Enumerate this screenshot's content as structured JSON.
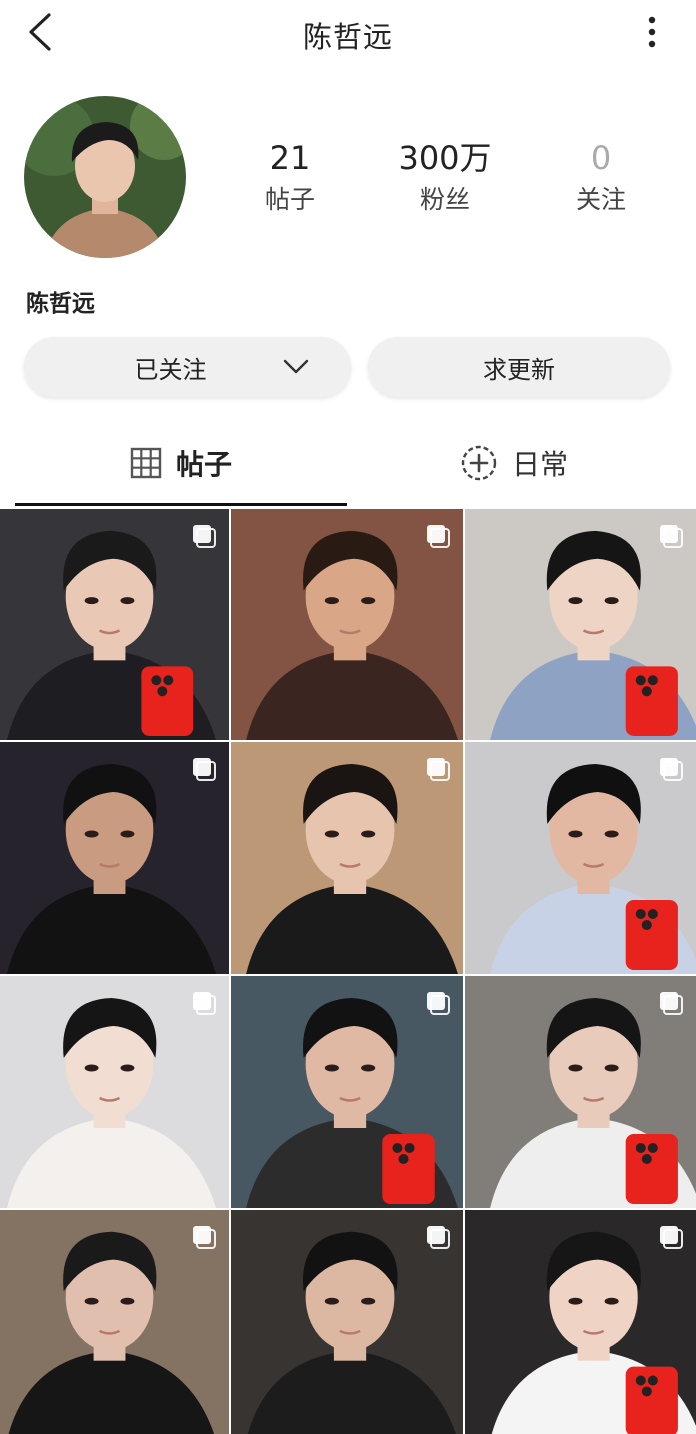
{
  "header": {
    "title": "陈哲远"
  },
  "profile": {
    "name": "陈哲远",
    "stats": [
      {
        "value": "21",
        "label": "帖子"
      },
      {
        "value": "300万",
        "label": "粉丝"
      },
      {
        "value": "0",
        "label": "关注"
      }
    ]
  },
  "actions": {
    "follow_label": "已关注",
    "update_label": "求更新"
  },
  "tabs": [
    {
      "label": "帖子",
      "icon": "grid-icon",
      "active": true
    },
    {
      "label": "日常",
      "icon": "add-circle-icon",
      "active": false
    }
  ],
  "posts": [
    {
      "bg": "#3a3a3e",
      "skin": "#e9c9b6",
      "hair": "#1a1a1a",
      "shirt": "#1d1d22",
      "phone": true
    },
    {
      "bg": "#8c5a48",
      "skin": "#d9a687",
      "hair": "#2a1a14",
      "shirt": "#3a2520",
      "phone": false
    },
    {
      "bg": "#d9d6d2",
      "skin": "#eed4c4",
      "hair": "#151515",
      "shirt": "#8ea3c4",
      "phone": true
    },
    {
      "bg": "#2a2630",
      "skin": "#c99b80",
      "hair": "#111111",
      "shirt": "#121212",
      "phone": false
    },
    {
      "bg": "#c9a27e",
      "skin": "#e6c4ad",
      "hair": "#1a1412",
      "shirt": "#1a1a1a",
      "phone": false
    },
    {
      "bg": "#d7d7d9",
      "skin": "#e2b8a2",
      "hair": "#101010",
      "shirt": "#c8d2e6",
      "phone": true
    },
    {
      "bg": "#eaeaec",
      "skin": "#f1ddd2",
      "hair": "#151515",
      "shirt": "#f4f0ee",
      "phone": false
    },
    {
      "bg": "#4c5e6a",
      "skin": "#dfb9a3",
      "hair": "#121212",
      "shirt": "#2c2c2c",
      "phone": true
    },
    {
      "bg": "#8a8682",
      "skin": "#e8cbbb",
      "hair": "#151515",
      "shirt": "#eeeeee",
      "phone": true
    },
    {
      "bg": "#8d7a6a",
      "skin": "#e0bfae",
      "hair": "#1a1a1a",
      "shirt": "#161616",
      "phone": false
    },
    {
      "bg": "#3b3836",
      "skin": "#dcb7a2",
      "hair": "#121212",
      "shirt": "#1c1c1c",
      "phone": false
    },
    {
      "bg": "#2d2b2c",
      "skin": "#efd3c4",
      "hair": "#161616",
      "shirt": "#f4f4f4",
      "phone": true
    }
  ]
}
